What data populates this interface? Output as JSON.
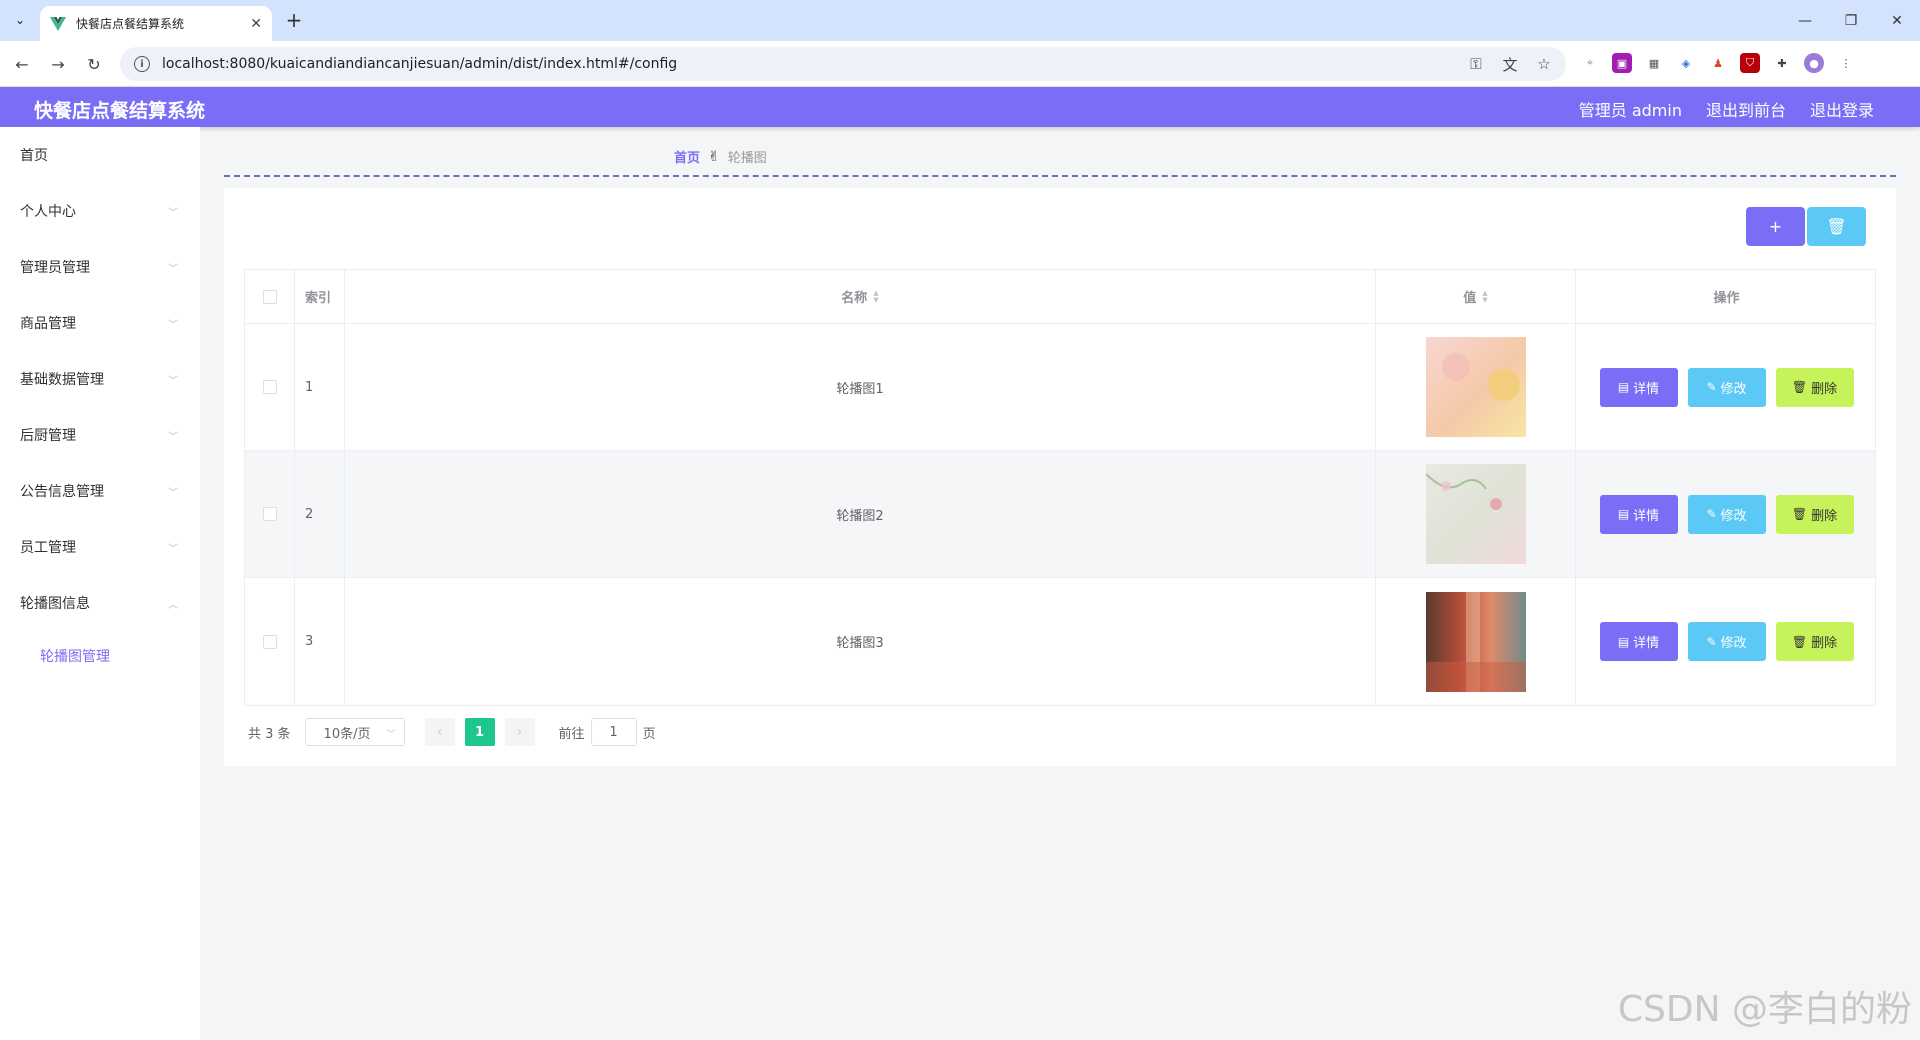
{
  "browser": {
    "tab_title": "快餐店点餐结算系统",
    "url": "localhost:8080/kuaicandiandiancanjiesuan/admin/dist/index.html#/config"
  },
  "header": {
    "app_title": "快餐店点餐结算系统",
    "admin_label": "管理员 admin",
    "to_frontend": "退出到前台",
    "logout": "退出登录"
  },
  "sidebar": {
    "items": [
      {
        "label": "首页"
      },
      {
        "label": "个人中心"
      },
      {
        "label": "管理员管理"
      },
      {
        "label": "商品管理"
      },
      {
        "label": "基础数据管理"
      },
      {
        "label": "后厨管理"
      },
      {
        "label": "公告信息管理"
      },
      {
        "label": "员工管理"
      },
      {
        "label": "轮播图信息"
      }
    ],
    "submenu": {
      "label": "轮播图管理"
    }
  },
  "breadcrumb": {
    "home": "首页",
    "current": "轮播图"
  },
  "actions": {
    "add": "+",
    "delete_all": "🗑"
  },
  "table": {
    "headers": {
      "index": "索引",
      "name": "名称",
      "value": "值",
      "operation": "操作"
    },
    "rows": [
      {
        "index": "1",
        "name": "轮播图1",
        "thumb_colors": [
          "#f7d7d3",
          "#f5c9a8",
          "#f7e6a2"
        ]
      },
      {
        "index": "2",
        "name": "轮播图2",
        "thumb_colors": [
          "#eae8e2",
          "#dfe3d6",
          "#f1d9dc"
        ]
      },
      {
        "index": "3",
        "name": "轮播图3",
        "thumb_colors": [
          "#b74d3a",
          "#e08a6b",
          "#5a3b2f"
        ]
      }
    ],
    "buttons": {
      "detail": "详情",
      "edit": "修改",
      "delete": "删除"
    }
  },
  "pagination": {
    "total": "共 3 条",
    "page_size": "10条/页",
    "current_page": "1",
    "goto_label": "前往",
    "goto_value": "1",
    "page_unit": "页"
  },
  "watermark": "CSDN @李白的粉",
  "colors": {
    "primary": "#7b6ef6",
    "info": "#5bc8f5",
    "lime": "#c6f25a",
    "page_active": "#1ec58e"
  }
}
